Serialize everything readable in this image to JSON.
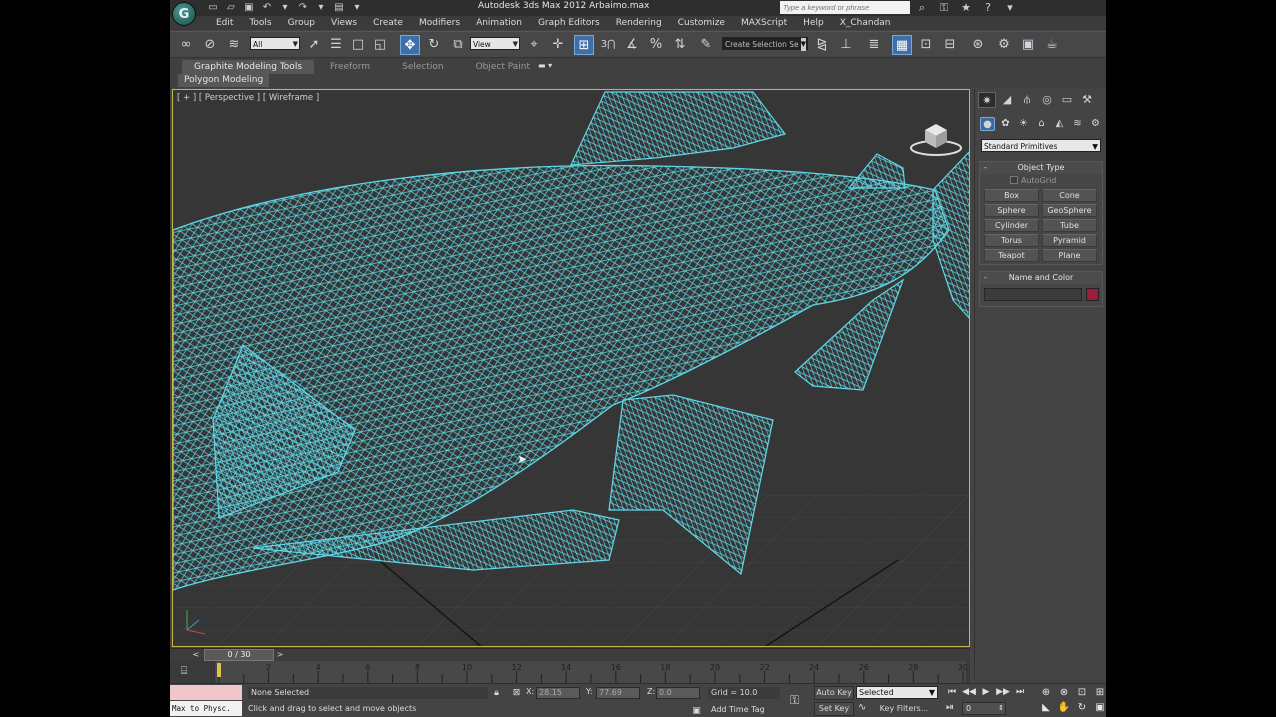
{
  "window": {
    "title": "Autodesk 3ds Max 2012    Arbaimo.max",
    "logo": "G",
    "search_placeholder": "Type a keyword or phrase"
  },
  "menu": [
    "Edit",
    "Tools",
    "Group",
    "Views",
    "Create",
    "Modifiers",
    "Animation",
    "Graph Editors",
    "Rendering",
    "Customize",
    "MAXScript",
    "Help",
    "X_Chandan"
  ],
  "toolbar": {
    "selection_filter": "All",
    "reference_coord": "View",
    "named_selection": "Create Selection Se"
  },
  "ribbon": {
    "tabs": [
      "Graphite Modeling Tools",
      "Freeform",
      "Selection",
      "Object Paint"
    ],
    "active_tab": "Graphite Modeling Tools",
    "panel": "Polygon Modeling",
    "pin": "▬ ▾"
  },
  "viewport": {
    "label": "[ + ] [ Perspective ] [ Wireframe ]",
    "wire_color": "#5ed8e8"
  },
  "command_panel": {
    "primitive_type": "Standard Primitives",
    "object_type_title": "Object Type",
    "autogrid_label": "AutoGrid",
    "buttons": [
      "Box",
      "Cone",
      "Sphere",
      "GeoSphere",
      "Cylinder",
      "Tube",
      "Torus",
      "Pyramid",
      "Teapot",
      "Plane"
    ],
    "name_color_title": "Name and Color",
    "object_color": "#9c1c3c"
  },
  "timeline": {
    "current": "0 / 30",
    "ticks": [
      "2",
      "4",
      "6",
      "8",
      "10",
      "12",
      "14",
      "16",
      "18",
      "20",
      "22",
      "24",
      "26",
      "28",
      "30"
    ]
  },
  "status": {
    "maxscript": "Max to Physc.",
    "selection": "None Selected",
    "prompt": "Click and drag to select and move objects",
    "x_label": "X:",
    "x_value": "28.15",
    "y_label": "Y:",
    "y_value": "77.69",
    "z_label": "Z:",
    "z_value": "0.0",
    "grid": "Grid = 10.0",
    "add_time_tag": "Add Time Tag",
    "auto_key": "Auto Key",
    "key_mode": "Selected",
    "set_key": "Set Key",
    "key_filters": "Key Filters...",
    "frame": "0"
  }
}
